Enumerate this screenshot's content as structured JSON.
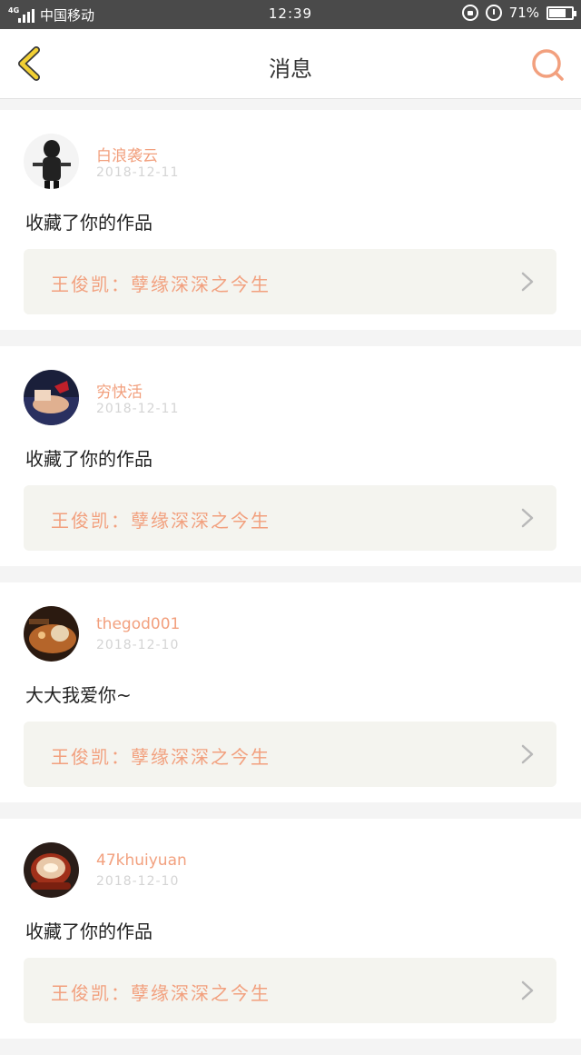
{
  "status_bar": {
    "network": "4G",
    "carrier": "中国移动",
    "time": "12:39",
    "battery": "71%"
  },
  "header": {
    "title": "消息",
    "back_icon": "chevron-left-icon",
    "search_icon": "search-icon"
  },
  "colors": {
    "accent": "#f2a07e",
    "back_icon": "#f2d033",
    "card_bg": "#ffffff",
    "page_bg": "#f4f4f4",
    "work_bg": "#f4f4ef"
  },
  "messages": [
    {
      "user": "白浪袭云",
      "date": "2018-12-11",
      "text": "收藏了你的作品",
      "work_title": "王俊凯：孽缘深深之今生"
    },
    {
      "user": "穷快活",
      "date": "2018-12-11",
      "text": "收藏了你的作品",
      "work_title": "王俊凯：孽缘深深之今生"
    },
    {
      "user": "thegod001",
      "date": "2018-12-10",
      "text": "大大我爱你~",
      "work_title": "王俊凯：孽缘深深之今生"
    },
    {
      "user": "47khuiyuan",
      "date": "2018-12-10",
      "text": "收藏了你的作品",
      "work_title": "王俊凯：孽缘深深之今生"
    }
  ]
}
